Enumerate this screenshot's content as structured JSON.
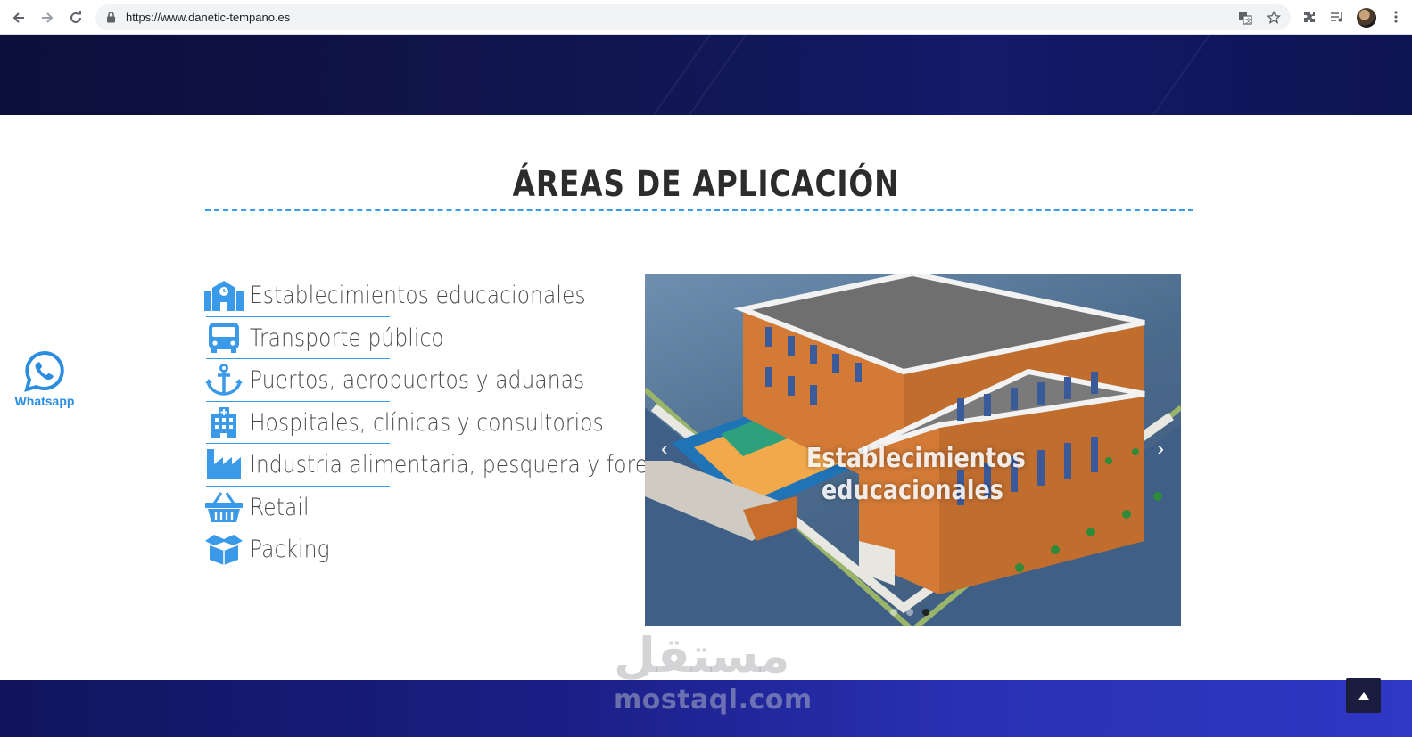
{
  "browser": {
    "url": "https://www.danetic-tempano.es",
    "icons": [
      "back-arrow-icon",
      "forward-arrow-icon",
      "reload-icon",
      "lock-icon",
      "translate-icon",
      "star-icon",
      "extensions-icon",
      "media-icon",
      "profile-avatar",
      "menu-icon"
    ]
  },
  "section": {
    "title": "ÁREAS DE APLICACIÓN",
    "accent_color": "#3a9ae8"
  },
  "areas": [
    {
      "label": "Establecimientos educacionales",
      "icon": "school-icon"
    },
    {
      "label": "Transporte público",
      "icon": "bus-icon"
    },
    {
      "label": "Puertos, aeropuertos y aduanas",
      "icon": "anchor-icon"
    },
    {
      "label": "Hospitales, clínicas y consultorios",
      "icon": "hospital-icon"
    },
    {
      "label": "Industria alimentaria, pesquera y forestal",
      "icon": "factory-icon"
    },
    {
      "label": "Retail",
      "icon": "basket-icon"
    },
    {
      "label": "Packing",
      "icon": "box-icon"
    }
  ],
  "carousel": {
    "caption": "Establecimientos educacionales",
    "slide_count": 3,
    "active_slide": 3
  },
  "whatsapp": {
    "label": "Whatsapp"
  },
  "watermark": {
    "arabic": "مستقل",
    "latin": "mostaql.com"
  },
  "colors": {
    "header_band": "#111651",
    "footer_band": "#1a1f86",
    "icon_blue": "#3a9ae8"
  }
}
